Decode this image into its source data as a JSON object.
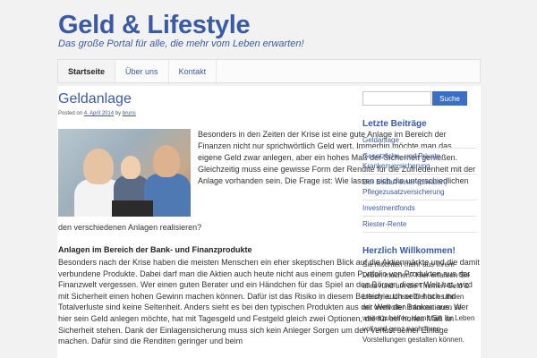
{
  "site": {
    "title": "Geld & Lifestyle",
    "description": "Das große Portal für alle, die mehr vom Leben erwarten!"
  },
  "nav": {
    "items": [
      {
        "label": "Startseite",
        "active": true
      },
      {
        "label": "Über uns",
        "active": false
      },
      {
        "label": "Kontakt",
        "active": false
      }
    ]
  },
  "post": {
    "title": "Geldanlage",
    "meta_prefix": "Posted on",
    "date": "4. April 2014",
    "meta_by": "by",
    "author": "bruns",
    "intro": "Besonders in den Zeiten der Krise ist eine gute Anlage im Bereich der Finanzen nicht nur sprichwörtlich Geld wert. Immerhin möchte man das eigene Geld zwar anlegen, aber ein hohes Maß der Sicherheit genießen. Gleichzeitig muss eine gewisse Form der Rendite für die Zufriedenheit mit der Anlage vorhanden sein. Die Frage ist: Wie lassen sich die unterschiedlichen",
    "intro_tail": "den verschiedenen Anlagen realisieren?",
    "section_heading": "Anlagen im Bereich der Bank- und Finanzprodukte",
    "body": "Besonders nach der Krise haben die meisten Menschen ein eher skeptischen Blick auf die Aktienmärkte und die damit verbundene Produkte. Dabei darf man die Aktien auch heute nicht aus einem guten Portfolio von Produkten aus der Finanzwelt vergessen. Wer einen guten Berater und ein Händchen für das Spiel an den Börsen dieser Welt hat, wird mit Sicherheit einen hohen Gewinn machen können. Dafür ist das Risiko in diesem Bereich auch sehr hoch und Totalverluste sind keine Seltenheit. Anders sieht es bei den typischen Produkten aus der Welt der Banken aus. Wer hier sein Geld anlegen möchte, hat mit Tagesgeld und Festgeld gleich zwei Optionen, die für ein hohes Maß an Sicherheit stehen. Dank der Einlagensicherung muss sich kein Anleger Sorgen um den Verlust seiner Einlage machen. Dafür sind die Renditen geringer und beim"
  },
  "sidebar": {
    "search_placeholder": "",
    "search_button": "Suche",
    "recent_title": "Letzte Beiträge",
    "recent_posts": [
      "Geldanlage",
      "Gesetzliche- und Private Krankenversicherung",
      "Der Bedarf einer (privaten) Pflegezusatzversicherung",
      "Investmentfonds",
      "Riester-Rente"
    ],
    "welcome_title": "Herzlich Willkommen!",
    "welcome_text": "Sie möchten mehr aus Ihrem Leben machen? Hier erfahren Sie alles rund um die Themen Geld & Lifestyle. Unser Ziel ist es Ihnen mit wertvollen Informationen so weiterzuhelfen, damit Sie Ihr Leben voll und ganz nach Ihren Vorstellungen gestalten können."
  },
  "colors": {
    "accent": "#3a5aa5",
    "button": "#3a6fc4",
    "background": "#f2f2f2"
  }
}
